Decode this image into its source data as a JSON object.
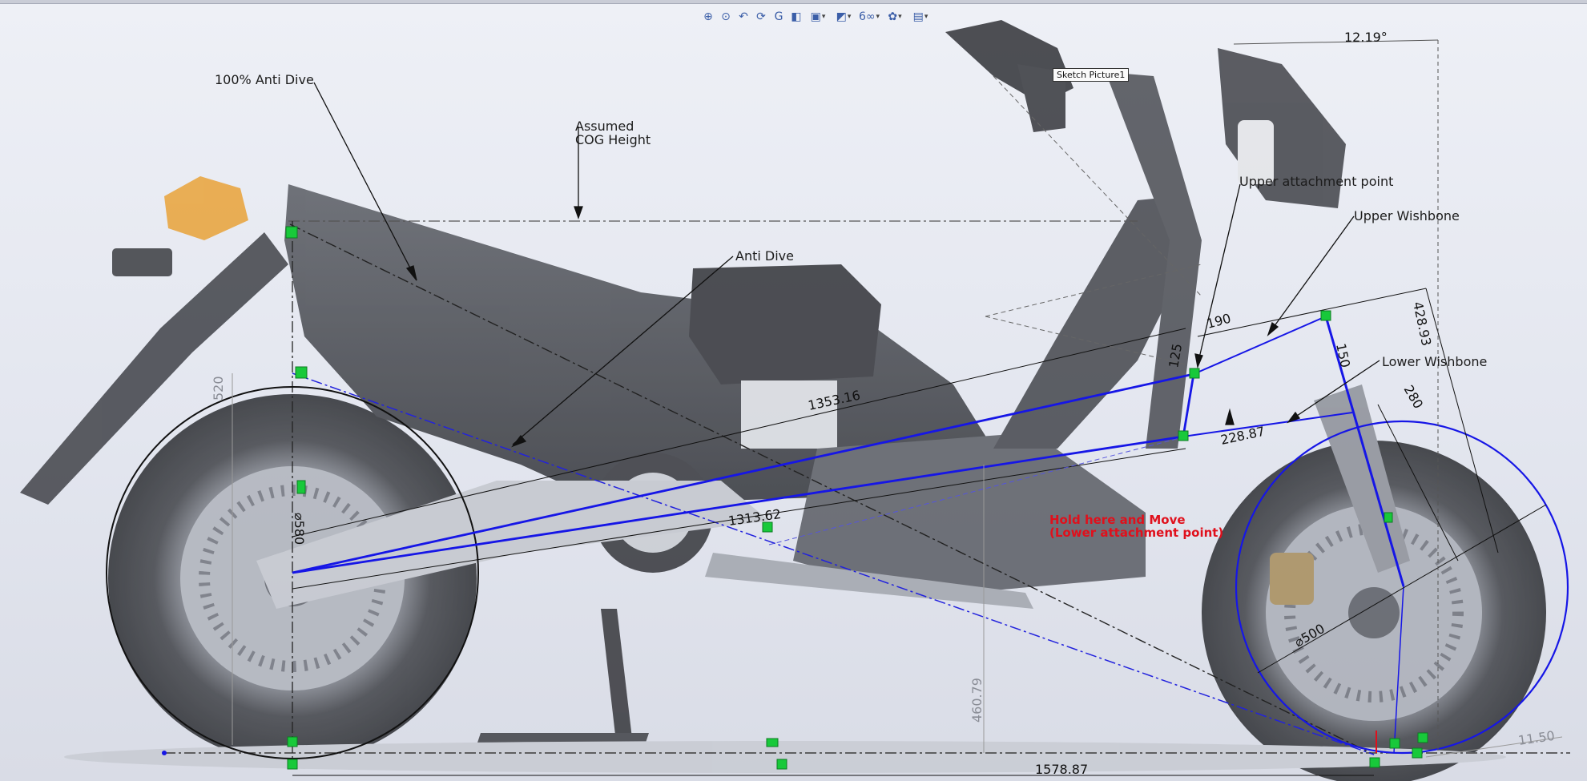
{
  "toolbar": {
    "buttons": [
      {
        "name": "zoom-to-fit-icon",
        "glyph": "⊕"
      },
      {
        "name": "zoom-to-area-icon",
        "glyph": "⊙"
      },
      {
        "name": "previous-view-icon",
        "glyph": "↶"
      },
      {
        "name": "rotate-icon",
        "glyph": "⟳"
      },
      {
        "name": "3d-drawing-view-icon",
        "glyph": "G"
      },
      {
        "name": "section-view-icon",
        "glyph": "◧"
      },
      {
        "name": "view-orientation-icon",
        "glyph": "▣",
        "dropdown": true
      },
      {
        "name": "display-style-icon",
        "glyph": "◩",
        "dropdown": true
      },
      {
        "name": "hide-show-items-icon",
        "glyph": "6∞",
        "dropdown": true
      },
      {
        "name": "edit-appearance-icon",
        "glyph": "✿",
        "dropdown": true
      },
      {
        "name": "view-settings-icon",
        "glyph": "▤",
        "dropdown": true
      }
    ]
  },
  "sketch_picture_label": "Sketch Picture1",
  "annotations": {
    "anti_dive_100": "100% Anti Dive",
    "assumed_cog_line1": "Assumed",
    "assumed_cog_line2": "COG Height",
    "anti_dive": "Anti Dive",
    "upper_attachment": "Upper attachment point",
    "upper_wishbone": "Upper Wishbone",
    "lower_wishbone": "Lower Wishbone",
    "hold_move_line1": "Hold here and Move",
    "hold_move_line2": "(Lower attachment point)"
  },
  "dimensions": {
    "angle_top": "12.19°",
    "d_428": "428.93",
    "d_190": "190",
    "d_150": "150",
    "d_125": "125",
    "d_280": "280",
    "d_228": "228.87",
    "d_1353": "1353.16",
    "d_1313": "1313.62",
    "d_rear_dia": "⌀580",
    "d_front_dia": "⌀500",
    "d_520": "520",
    "d_460": "460.79",
    "d_1578": "1578.87",
    "d_11_50": "11.50"
  },
  "colors": {
    "sketch_blue": "#1616e6",
    "sketch_black": "#111111",
    "relation_green": "#18c93a",
    "warning_red": "#e0101c"
  }
}
